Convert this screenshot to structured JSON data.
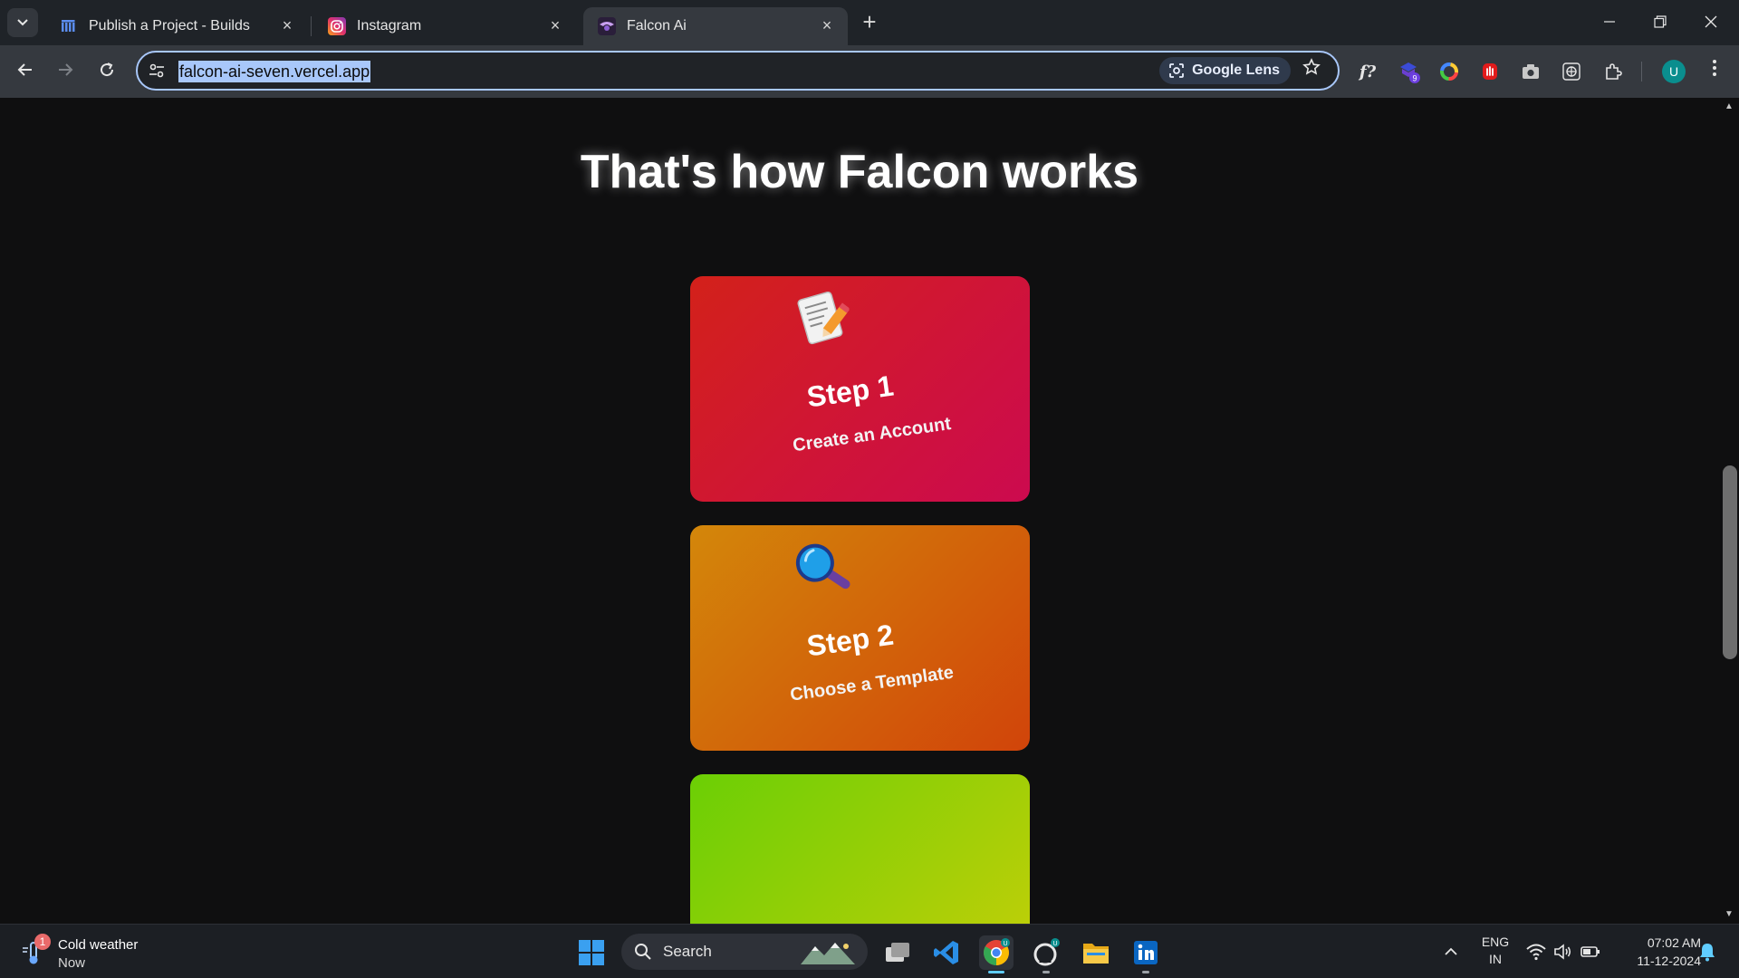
{
  "browser": {
    "tabs": [
      {
        "title": "Publish a Project - Builds",
        "active": false
      },
      {
        "title": "Instagram",
        "active": false
      },
      {
        "title": "Falcon Ai",
        "active": true
      }
    ],
    "address_bar": {
      "url": "falcon-ai-seven.vercel.app",
      "lens_label": "Google Lens"
    },
    "profile_initial": "U",
    "extension_badge": "9",
    "extension_label": "f?"
  },
  "page": {
    "heading": "That's how Falcon works",
    "steps": [
      {
        "title": "Step 1",
        "subtitle": "Create an Account",
        "icon": "memo-icon",
        "color_start": "#d3211a",
        "color_end": "#cc0a4f"
      },
      {
        "title": "Step 2",
        "subtitle": "Choose a Template",
        "icon": "magnifier-icon",
        "color_start": "#d3870a",
        "color_end": "#d1440a"
      },
      {
        "title": "",
        "subtitle": "",
        "icon": "",
        "color_start": "#6bcf05",
        "color_end": "#c3cf08"
      }
    ]
  },
  "taskbar": {
    "weather": {
      "title": "Cold weather",
      "subtitle": "Now",
      "badge": "1"
    },
    "search_placeholder": "Search",
    "language": {
      "line1": "ENG",
      "line2": "IN"
    },
    "clock": {
      "time": "07:02 AM",
      "date": "11-12-2024"
    },
    "chrome_badge": "U",
    "github_badge": "U"
  },
  "colors": {
    "page_background": "#0f0f10",
    "address_highlight": "#a8c7fa"
  }
}
